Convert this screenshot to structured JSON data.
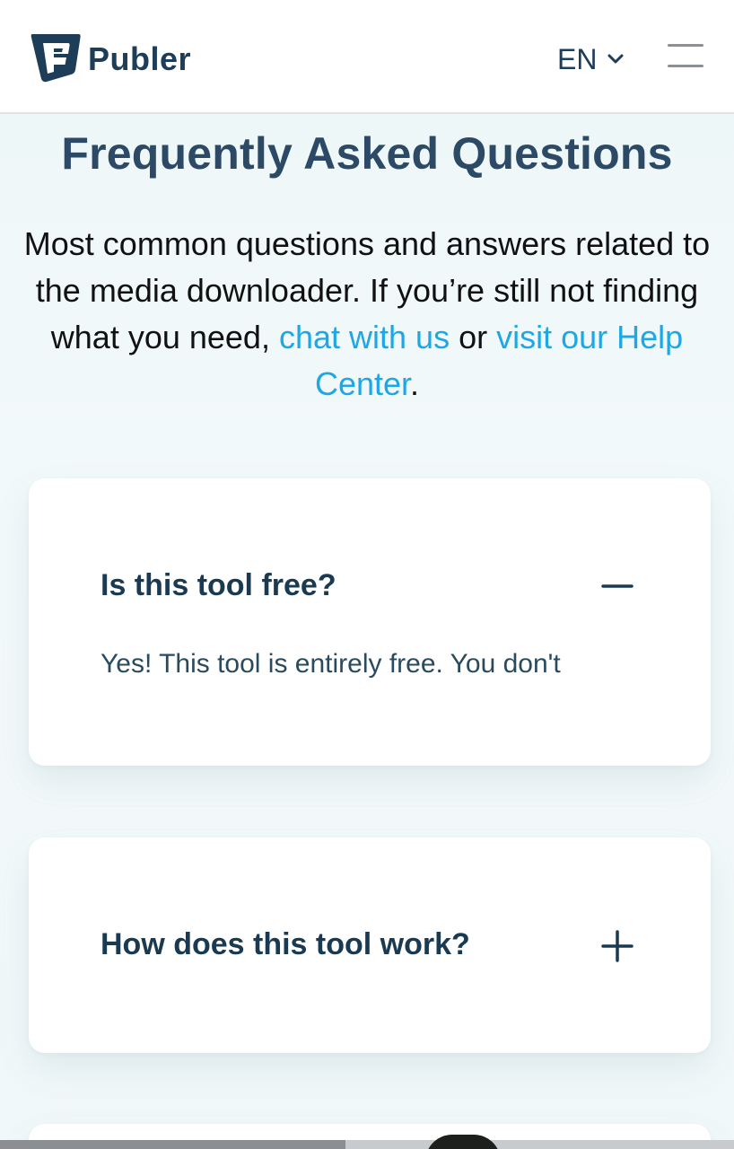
{
  "header": {
    "brand": "Publer",
    "language": "EN"
  },
  "faq": {
    "title": "Frequently Asked Questions",
    "intro_text": "Most common questions and answers related to the media downloader. If you’re still not finding what you need,",
    "chat_link": "chat with us",
    "or_text": "or",
    "help_link": "visit our Help Center",
    "period": ".",
    "items": [
      {
        "question": "Is this tool free?",
        "answer": "Yes! This tool is entirely free. You don't",
        "expanded": true,
        "toggle_icon": "minus-icon"
      },
      {
        "question": "How does this tool work?",
        "expanded": false,
        "toggle_icon": "plus-icon"
      }
    ]
  },
  "colors": {
    "brand": "#1e3d58",
    "link": "#1ea7e4",
    "title": "#2c4a66"
  }
}
